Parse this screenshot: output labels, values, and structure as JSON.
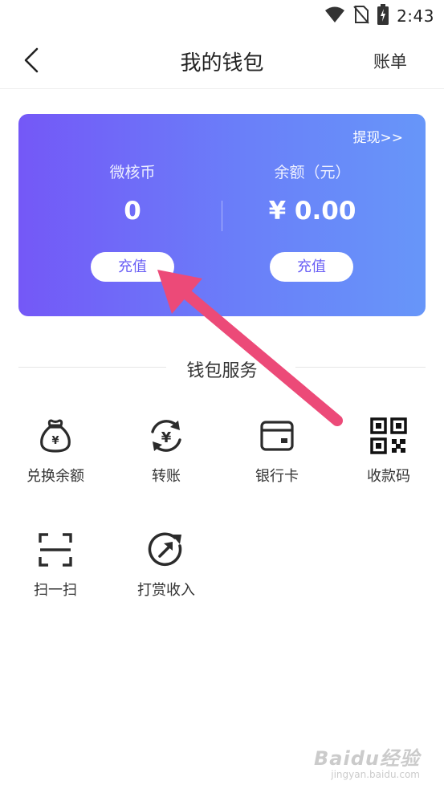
{
  "status_bar": {
    "time": "2:43",
    "icons": [
      "wifi-icon",
      "no-sim-icon",
      "battery-charging-icon"
    ]
  },
  "nav": {
    "title": "我的钱包",
    "right_label": "账单",
    "back_icon": "chevron-left-icon"
  },
  "wallet_card": {
    "withdraw_label": "提现>>",
    "coins": {
      "label": "微核币",
      "value": "0",
      "button": "充值"
    },
    "balance": {
      "label": "余额（元）",
      "value": "¥ 0.00",
      "button": "充值"
    },
    "gradient": [
      "#7458f7",
      "#6796f9"
    ]
  },
  "services": {
    "title": "钱包服务",
    "items": [
      {
        "label": "兑换余额",
        "icon": "money-bag-icon"
      },
      {
        "label": "转账",
        "icon": "transfer-yuan-icon"
      },
      {
        "label": "银行卡",
        "icon": "bank-card-icon"
      },
      {
        "label": "收款码",
        "icon": "qr-code-icon"
      },
      {
        "label": "扫一扫",
        "icon": "scan-icon"
      },
      {
        "label": "打赏收入",
        "icon": "reward-income-icon"
      }
    ]
  },
  "annotation": {
    "color": "#ec4a78"
  },
  "watermark": {
    "brand": "Baidu经验",
    "url": "jingyan.baidu.com"
  }
}
